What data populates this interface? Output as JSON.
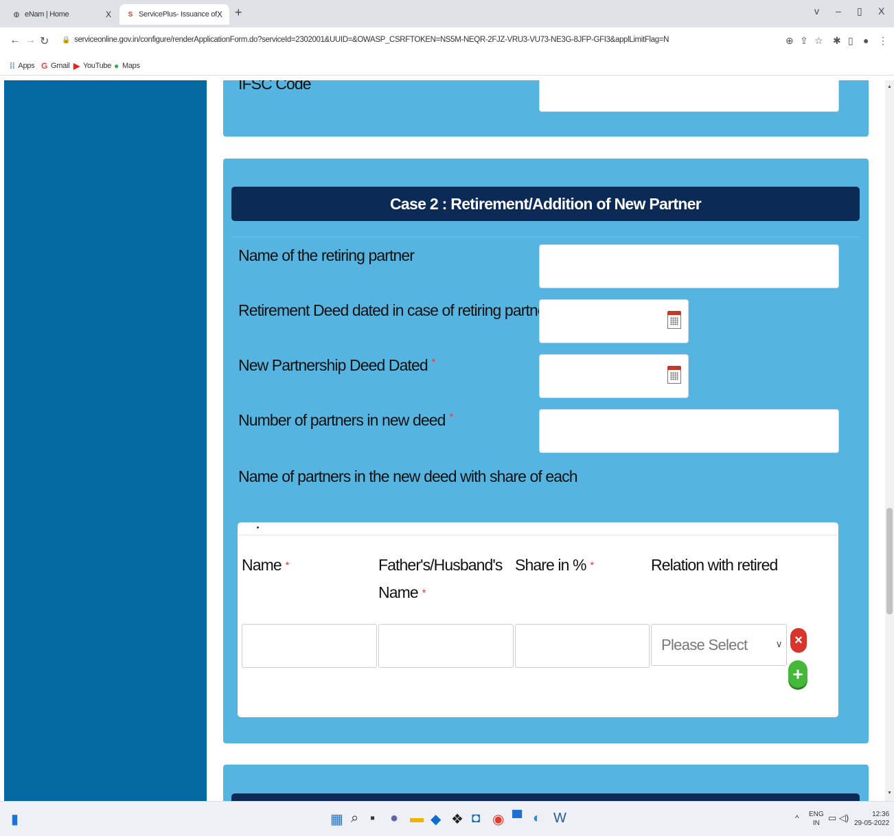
{
  "browser": {
    "tabs": [
      {
        "title": "eNam | Home",
        "close": "X",
        "active": false
      },
      {
        "title": "ServicePlus- Issuance of new Lic",
        "close": "X",
        "active": true
      }
    ],
    "new_tab": "+",
    "window_controls": [
      "v",
      "–",
      "▯",
      "X"
    ],
    "url": "serviceonline.gov.in/configure/renderApplicationForm.do?serviceId=2302001&UUID=&OWASP_CSRFTOKEN=NS5M-NEQR-2FJZ-VRU3-VU73-NE3G-8JFP-GFI3&applLimitFlag=N",
    "bookmarks": [
      "Apps",
      "Gmail",
      "YouTube",
      "Maps"
    ]
  },
  "form": {
    "prev_section": {
      "label": "IFSC Code"
    },
    "case2": {
      "title": "Case 2 : Retirement/Addition of New Partner",
      "fields": [
        {
          "label": "Name of the retiring partner",
          "required": false
        },
        {
          "label": "Retirement Deed dated in case of retiring partner",
          "required": false
        },
        {
          "label": "New Partnership Deed Dated",
          "required": true
        },
        {
          "label": "Number of partners in new deed",
          "required": true
        },
        {
          "label": "Name of partners in the new deed with share of each",
          "required": false
        }
      ],
      "required_mark": "*",
      "table": {
        "columns": [
          {
            "label": "Name",
            "required": true
          },
          {
            "label": "Father's/Husband's Name",
            "required": true
          },
          {
            "label": "Share in %",
            "required": true
          },
          {
            "label": "Relation with retired",
            "required": false
          }
        ],
        "row": {
          "select_value": "Please Select"
        }
      }
    }
  },
  "taskbar": {
    "lang": "ENG",
    "region": "IN",
    "time": "12:36",
    "date": "29-05-2022"
  },
  "colors": {
    "sidebar": "#0369a0",
    "panel": "#55b4e0",
    "header_bar": "#0c2a56",
    "required": "#e33322"
  }
}
